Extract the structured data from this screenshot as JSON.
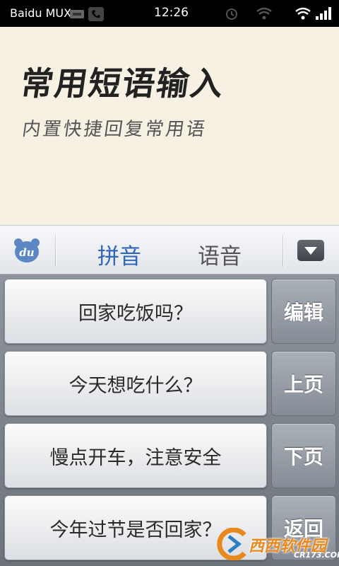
{
  "status_bar": {
    "carrier": "Baidu MUX",
    "time": "12:26",
    "icons": [
      "usb-icon",
      "phone-icon",
      "alarm-icon",
      "wifi-icon",
      "signal-icon",
      "battery-icon"
    ]
  },
  "banner": {
    "title": "常用短语输入",
    "subtitle": "内置快捷回复常用语"
  },
  "ime_toolbar": {
    "logo": "du",
    "tabs": [
      {
        "label": "拼音",
        "active": true
      },
      {
        "label": "语音",
        "active": false
      }
    ],
    "dropdown_icon": "triangle-down-icon"
  },
  "phrases": [
    "回家吃饭吗？",
    "今天想吃什么？",
    "慢点开车，注意安全",
    "今年过节是否回家？"
  ],
  "side_buttons": {
    "edit": "编辑",
    "prev_page": "上页",
    "next_page": "下页",
    "back": "返回"
  },
  "watermark": {
    "brand": "西西软件园",
    "url": "CR173.COM"
  },
  "colors": {
    "active_tab": "#2f66b8",
    "banner_bg": "#f7f1e3",
    "watermark": "#e8891e"
  }
}
